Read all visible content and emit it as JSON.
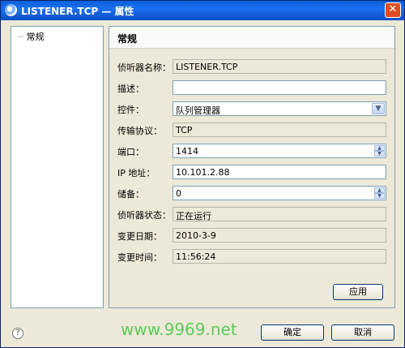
{
  "window": {
    "title": "LISTENER.TCP — 属性",
    "close_glyph": "✕"
  },
  "tree": {
    "branch": "··",
    "node_label": "常规"
  },
  "panel": {
    "heading": "常规"
  },
  "fields": [
    {
      "label": "侦听器名称：",
      "value": "LISTENER.TCP",
      "kind": "readonly"
    },
    {
      "label": "描述：",
      "value": "",
      "kind": "text"
    },
    {
      "label": "控件：",
      "value": "队列管理器",
      "kind": "combo"
    },
    {
      "label": "传输协议：",
      "value": "TCP",
      "kind": "readonly"
    },
    {
      "label": "端口：",
      "value": "1414",
      "kind": "spin"
    },
    {
      "label": "IP 地址：",
      "value": "10.101.2.88",
      "kind": "text"
    },
    {
      "label": "储备：",
      "value": "0",
      "kind": "spin"
    },
    {
      "label": "侦听器状态：",
      "value": "正在运行",
      "kind": "readonly"
    },
    {
      "label": "变更日期：",
      "value": "2010-3-9",
      "kind": "readonly"
    },
    {
      "label": "变更时间：",
      "value": "11:56:24",
      "kind": "readonly"
    }
  ],
  "buttons": {
    "apply": "应用",
    "ok": "确定",
    "cancel": "取消",
    "help": "?"
  },
  "watermark": "www.9969.net",
  "colors": {
    "titlebar": "#0b4fc6",
    "watermark": "#2fbf2f"
  }
}
